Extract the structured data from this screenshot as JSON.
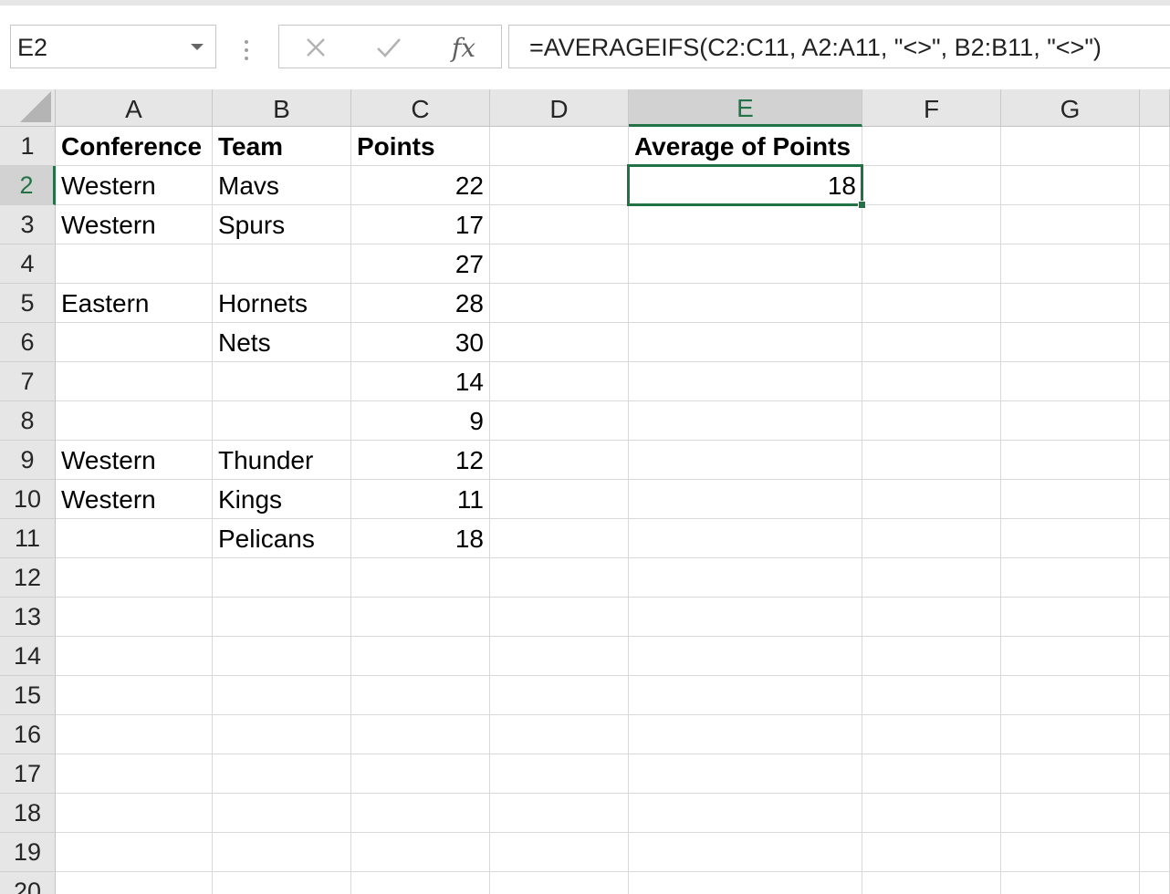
{
  "formula_bar": {
    "name_box": "E2",
    "formula": "=AVERAGEIFS(C2:C11, A2:A11, \"<>\", B2:B11, \"<>\")",
    "cancel_icon": "close-icon",
    "enter_icon": "check-icon",
    "function_icon": "fx-icon",
    "function_label": "fx"
  },
  "sheet": {
    "columns": [
      "A",
      "B",
      "C",
      "D",
      "E",
      "F",
      "G"
    ],
    "rows": [
      "1",
      "2",
      "3",
      "4",
      "5",
      "6",
      "7",
      "8",
      "9",
      "10",
      "11",
      "12",
      "13",
      "14",
      "15",
      "16",
      "17",
      "18",
      "19",
      "20"
    ],
    "selected_cell": "E2",
    "cells": {
      "A1": "Conference",
      "B1": "Team",
      "C1": "Points",
      "E1": "Average of Points",
      "A2": "Western",
      "B2": "Mavs",
      "C2": "22",
      "E2": "18",
      "A3": "Western",
      "B3": "Spurs",
      "C3": "17",
      "C4": "27",
      "A5": "Eastern",
      "B5": "Hornets",
      "C5": "28",
      "B6": "Nets",
      "C6": "30",
      "C7": "14",
      "C8": "9",
      "A9": "Western",
      "B9": "Thunder",
      "C9": "12",
      "A10": "Western",
      "B10": "Kings",
      "C10": "11",
      "B11": "Pelicans",
      "C11": "18"
    },
    "bold_cells": [
      "A1",
      "B1",
      "C1",
      "E1"
    ],
    "numeric_cells": [
      "C2",
      "C3",
      "C4",
      "C5",
      "C6",
      "C7",
      "C8",
      "C9",
      "C10",
      "C11",
      "E2"
    ]
  },
  "colors": {
    "accent": "#217346",
    "header_bg": "#e6e6e6",
    "header_active_bg": "#d2d2d2",
    "gridline": "#d9d9d9"
  }
}
